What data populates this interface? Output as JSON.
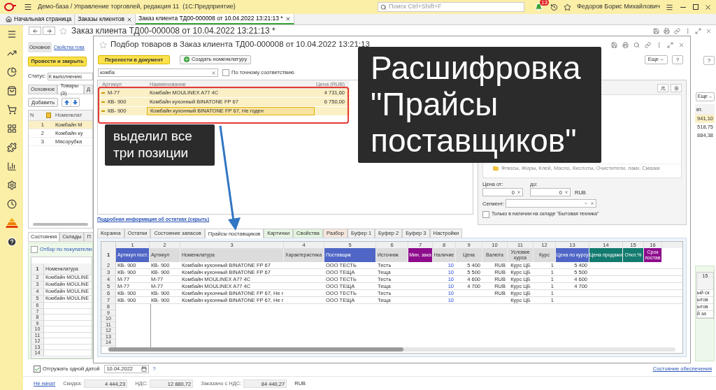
{
  "app_bar": {
    "title": "Демо-база / Управление торговлей, редакция 11  (1С:Предприятие)",
    "search_placeholder": "Поиск Ctrl+Shift+F",
    "notifications": "13",
    "user": "Федоров Борис Михайлович"
  },
  "open_tabs": [
    {
      "label": "Начальная страница",
      "selected": false,
      "closable": false
    },
    {
      "label": "Заказы клиентов",
      "selected": false,
      "closable": true
    },
    {
      "label": "Заказ клиента ТД00-000008 от 10.04.2022 13:21:13 *",
      "selected": true,
      "closable": true
    }
  ],
  "order_form": {
    "title": "Заказ клиента ТД00-000008 от 10.04.2022 13:21:13 *",
    "nav": [
      {
        "label": "Основное",
        "selected": true
      },
      {
        "label": "Свойства това",
        "selected": false
      }
    ],
    "post_button": "Провести и закрыть",
    "help_button": "?",
    "status_label": "Статус:",
    "status_value": "К выполнению",
    "tabs": [
      {
        "label": "Основное",
        "selected": false
      },
      {
        "label": "Товары (3)",
        "selected": true
      },
      {
        "label": "Д",
        "selected": false
      }
    ],
    "add_button": "Добавить",
    "more_button": "Еще",
    "goods_table": {
      "n_header": "N",
      "name_header": "Номенклат",
      "tail_header": "вт.",
      "rows": [
        {
          "n": "1",
          "name": "Комбайн М",
          "tail": "941,10",
          "selected": true
        },
        {
          "n": "2",
          "name": "Комбайн ку",
          "tail": "518,75",
          "selected": false
        },
        {
          "n": "3",
          "name": "Мясорубка",
          "tail": "884,38",
          "selected": false
        }
      ]
    },
    "lower_tabs": [
      {
        "label": "Состояния",
        "selected": true
      },
      {
        "label": "Склады",
        "selected": false
      },
      {
        "label": "П",
        "selected": false
      }
    ],
    "buyer_filter": {
      "label": "Отбор по покупателю",
      "checked": false
    },
    "lower_sheet": {
      "tail_header": "15",
      "rows": [
        {
          "n": "1",
          "name": "Номенклатура",
          "tail": "",
          "header": true
        },
        {
          "n": "2",
          "name": "Комбайн MOULINE",
          "tail": "ый ск",
          "header": false
        },
        {
          "n": "3",
          "name": "Комбайн MOULINE",
          "tail": "ытов",
          "header": false
        },
        {
          "n": "4",
          "name": "Комбайн MOULINE",
          "tail": "ытов",
          "header": false
        },
        {
          "n": "5",
          "name": "Комбайн MOULINE",
          "tail": "й за",
          "header": false
        },
        {
          "n": "6",
          "name": "",
          "tail": "",
          "header": false
        },
        {
          "n": "7",
          "name": "",
          "tail": "",
          "header": false
        },
        {
          "n": "8",
          "name": "",
          "tail": "",
          "header": false
        },
        {
          "n": "9",
          "name": "",
          "tail": "",
          "header": false
        },
        {
          "n": "10",
          "name": "",
          "tail": "",
          "header": false
        },
        {
          "n": "11",
          "name": "",
          "tail": "",
          "header": false
        },
        {
          "n": "12",
          "name": "",
          "tail": "",
          "header": false
        },
        {
          "n": "13",
          "name": "",
          "tail": "",
          "header": false
        },
        {
          "n": "14",
          "name": "",
          "tail": "",
          "header": false
        }
      ]
    },
    "ship_one_date": {
      "label": "Отгружать одной датой",
      "checked": true,
      "date": "10.04.2022",
      "help": "?"
    },
    "supply_link": "Состояние обеспечения",
    "footer": {
      "status_link": "Не начат",
      "fields": [
        {
          "label": "Скидка:",
          "value": "4 444,23"
        },
        {
          "label": "НДС:",
          "value": "12 880,72"
        },
        {
          "label": "Заказано с НДС:",
          "value": "84 440,27"
        }
      ],
      "currency": "RUB"
    }
  },
  "picker_dialog": {
    "title": "Подбор товаров в Заказ клиента ТД00-000008 от 10.04.2022 13:21:13",
    "transfer_button": "Перенести в документ",
    "create_button": "Создать номенклатуру",
    "more_button": "Еще",
    "help_button": "?",
    "search": {
      "value": "комба"
    },
    "exact_match": {
      "label": "По точному соответствию",
      "checked": false
    },
    "table": {
      "columns": [
        "Артикул",
        "Наименование",
        "Цена (RUB)"
      ],
      "rows": [
        {
          "article": "М-77",
          "name": "Комбайн MOULINEX A77 4C",
          "price": "4 731,60",
          "selected": true,
          "focused": false
        },
        {
          "article": "КВ- 900",
          "name": "Комбайн кухонный BINATONE FP 67",
          "price": "6 750,00",
          "selected": true,
          "focused": false
        },
        {
          "article": "КВ- 900",
          "name": "Комбайн кухонный BINATONE FP 67, Не годен",
          "price": "",
          "selected": true,
          "focused": true
        }
      ]
    },
    "stock_link": "Подробная информация об остатках (скрыть)",
    "tree": [
      {
        "label": "Флюсы, Жиры, Клей, Масло, Кислоты, Очистители, лаки, Смазки",
        "selected": false
      }
    ],
    "price_from_label": "Цена от:",
    "price_from": "0",
    "price_to_label": "до:",
    "price_to": "0",
    "price_currency": "RUB",
    "segment_label": "Сегмент:",
    "in_stock_only": {
      "label": "Только в наличии на складе \"Бытовая техника\"",
      "checked": false
    },
    "tabs": [
      {
        "label": "Корзина",
        "selected": false,
        "color": "#f0f0f0"
      },
      {
        "label": "Остатки",
        "selected": false,
        "color": "#f0f0f0"
      },
      {
        "label": "Состояние запасов",
        "selected": false,
        "color": "#f0f0f0"
      },
      {
        "label": "Прайсы поставщиков",
        "selected": true,
        "color": "#ffffff"
      },
      {
        "label": "Картинки",
        "selected": false,
        "color": "#e8f5e4"
      },
      {
        "label": "Свойства",
        "selected": false,
        "color": "#e3f3de"
      },
      {
        "label": "Разбор",
        "selected": false,
        "color": "#f6e6dc"
      },
      {
        "label": "Буфер 1",
        "selected": false,
        "color": "#f0f0f0"
      },
      {
        "label": "Буфер 2",
        "selected": false,
        "color": "#f0f0f0"
      },
      {
        "label": "Буфер 3",
        "selected": false,
        "color": "#f0f0f0"
      },
      {
        "label": "Настройки",
        "selected": false,
        "color": "#f0f0f0"
      }
    ],
    "sheet": {
      "columns": [
        {
          "num": "1",
          "header": "Артикул пост.",
          "color": "#4f66c6",
          "kind": "text"
        },
        {
          "num": "2",
          "header": "Артикул",
          "color": "#dcdcdc",
          "kind": "text"
        },
        {
          "num": "3",
          "header": "Номенклатура",
          "color": "#dcdcdc",
          "kind": "text"
        },
        {
          "num": "4",
          "header": "Характеристика",
          "color": "#dcdcdc",
          "kind": "text"
        },
        {
          "num": "5",
          "header": "Поставщик",
          "color": "#4f66c6",
          "kind": "text"
        },
        {
          "num": "6",
          "header": "Источник",
          "color": "#dcdcdc",
          "kind": "text"
        },
        {
          "num": "7",
          "header": "Мин. зака",
          "color": "#8e0c8c",
          "kind": "number"
        },
        {
          "num": "8",
          "header": "Наличие",
          "color": "#dcdcdc",
          "kind": "quantity"
        },
        {
          "num": "9",
          "header": "Цена",
          "color": "#dcdcdc",
          "kind": "number"
        },
        {
          "num": "10",
          "header": "Валюта",
          "color": "#dcdcdc",
          "kind": "number"
        },
        {
          "num": "11",
          "header": "Условие курса",
          "color": "#dcdcdc",
          "kind": "center"
        },
        {
          "num": "12",
          "header": "Курс",
          "color": "#dcdcdc",
          "kind": "number"
        },
        {
          "num": "13",
          "header": "Цена по курсу",
          "color": "#4f66c6",
          "kind": "number"
        },
        {
          "num": "14",
          "header": "Цена продажи",
          "color": "#137a6f",
          "kind": "number"
        },
        {
          "num": "15",
          "header": "Откл.%",
          "color": "#137a6f",
          "kind": "number"
        },
        {
          "num": "16",
          "header": "Срок постав",
          "color": "#8e0c8c",
          "kind": "number"
        }
      ],
      "header_row": "1",
      "rows": [
        {
          "n": "2",
          "cells": [
            "КВ- 900",
            "КВ- 900",
            "Комбайн кухонный BINATONE FP 67",
            "",
            "ООО ТЕСТЬ",
            "Тесть",
            "",
            "10",
            "5 400",
            "RUB",
            "Курс ЦБ",
            "1",
            "5 400",
            "",
            "",
            ""
          ]
        },
        {
          "n": "3",
          "cells": [
            "КВ- 900",
            "КВ- 900",
            "Комбайн кухонный BINATONE FP 67",
            "",
            "ООО ТЕЩА",
            "Теща",
            "",
            "10",
            "5 500",
            "RUB",
            "Курс ЦБ",
            "1",
            "5 500",
            "",
            "",
            ""
          ]
        },
        {
          "n": "4",
          "cells": [
            "М-77",
            "М-77",
            "Комбайн MOULINEX A77 4C",
            "",
            "ООО ТЕСТЬ",
            "Тесть",
            "",
            "10",
            "4 600",
            "RUB",
            "Курс ЦБ",
            "1",
            "4 600",
            "",
            "",
            ""
          ]
        },
        {
          "n": "5",
          "cells": [
            "М-77",
            "М-77",
            "Комбайн MOULINEX A77 4C",
            "",
            "ООО ТЕЩА",
            "Теща",
            "",
            "10",
            "4 700",
            "RUB",
            "Курс ЦБ",
            "1",
            "4 700",
            "",
            "",
            ""
          ]
        },
        {
          "n": "6",
          "cells": [
            "КВ- 900",
            "КВ- 900",
            "Комбайн кухонный BINATONE FP 67, Не г",
            "",
            "ООО ТЕСТЬ",
            "Тесть",
            "",
            "10",
            "",
            "RUB",
            "Курс ЦБ",
            "1",
            "",
            "",
            "",
            ""
          ]
        },
        {
          "n": "7",
          "cells": [
            "КВ- 900",
            "КВ- 900",
            "Комбайн кухонный BINATONE FP 67, Не г",
            "",
            "ООО ТЕЩА",
            "Теща",
            "",
            "10",
            "",
            "",
            "Курс ЦБ",
            "1",
            "",
            "",
            "",
            ""
          ]
        }
      ],
      "empty_rows": [
        "8",
        "9",
        "10",
        "11",
        "12",
        "13",
        "14"
      ]
    }
  },
  "annotations": [
    {
      "kind": "note",
      "text": "выделил все три позиции"
    },
    {
      "kind": "caption",
      "text": "Расшифровка \"Прайсы поставщиков\""
    }
  ]
}
